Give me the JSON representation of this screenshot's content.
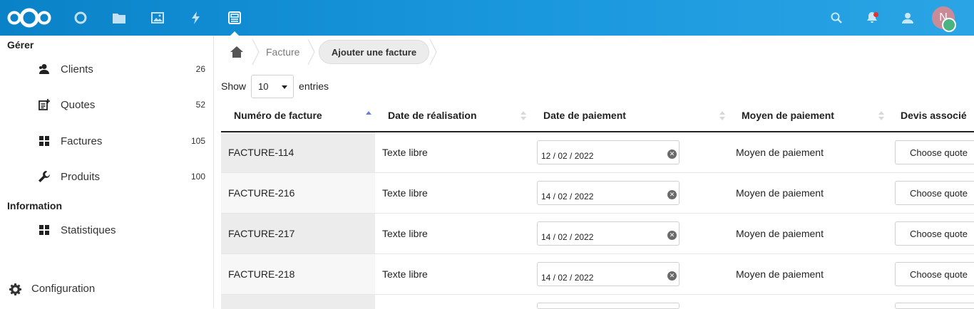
{
  "header": {
    "apps": [
      {
        "name": "logo"
      },
      {
        "name": "dashboard-icon"
      },
      {
        "name": "files-icon"
      },
      {
        "name": "photos-icon"
      },
      {
        "name": "activity-icon"
      },
      {
        "name": "invoice-app-icon"
      }
    ],
    "avatar_initial": "N",
    "accent": "#1a98de"
  },
  "sidebar": {
    "section1": "Gérer",
    "items": [
      {
        "label": "Clients",
        "count": "26",
        "icon": "users-icon"
      },
      {
        "label": "Quotes",
        "count": "52",
        "icon": "quote-icon"
      },
      {
        "label": "Factures",
        "count": "105",
        "icon": "grid-icon"
      },
      {
        "label": "Produits",
        "count": "100",
        "icon": "wrench-icon"
      }
    ],
    "section2": "Information",
    "stats": {
      "label": "Statistiques",
      "icon": "grid-icon"
    },
    "config": "Configuration"
  },
  "breadcrumb": {
    "crumb1": "Facture",
    "button": "Ajouter une facture"
  },
  "length": {
    "show": "Show",
    "value": "10",
    "entries": "entries"
  },
  "table": {
    "headers": [
      "Numéro de facture",
      "Date de réalisation",
      "Date de paiement",
      "Moyen de paiement",
      "Devis associé"
    ],
    "rows": [
      {
        "num": "FACTURE-114",
        "realisation": "Texte libre",
        "date": "12 / 02 / 2022",
        "moyen": "Moyen de paiement",
        "quote": "Choose quote"
      },
      {
        "num": "FACTURE-216",
        "realisation": "Texte libre",
        "date": "14 / 02 / 2022",
        "moyen": "Moyen de paiement",
        "quote": "Choose quote"
      },
      {
        "num": "FACTURE-217",
        "realisation": "Texte libre",
        "date": "14 / 02 / 2022",
        "moyen": "Moyen de paiement",
        "quote": "Choose quote"
      },
      {
        "num": "FACTURE-218",
        "realisation": "Texte libre",
        "date": "14 / 02 / 2022",
        "moyen": "Moyen de paiement",
        "quote": "Choose quote"
      }
    ]
  }
}
